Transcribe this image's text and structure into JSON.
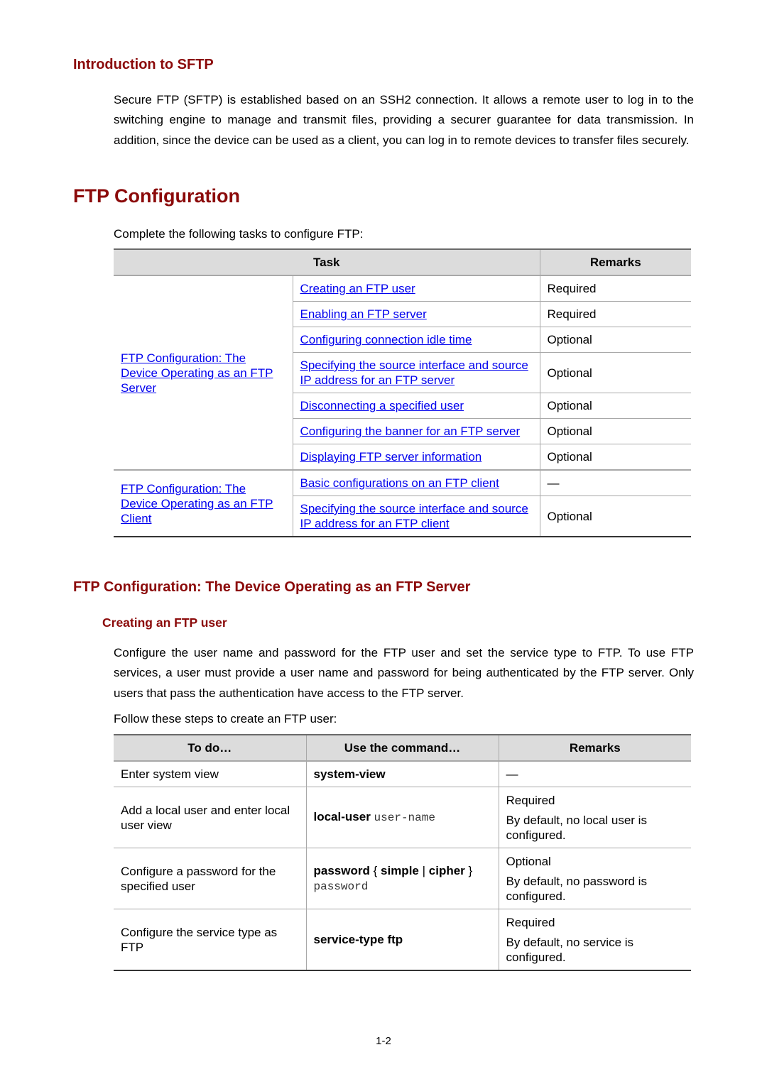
{
  "sections": {
    "intro": {
      "heading": "Introduction to SFTP",
      "paragraph": "Secure FTP (SFTP) is established based on an SSH2 connection. It allows a remote user to log in to the switching engine to manage and transmit files, providing a securer guarantee for data transmission. In addition, since the device can be used as a client, you can log in to remote devices to transfer files securely."
    },
    "ftp_config": {
      "heading": "FTP Configuration",
      "lead": "Complete the following tasks to configure FTP:",
      "table": {
        "headers": {
          "task": "Task",
          "remarks": "Remarks"
        },
        "groups": [
          {
            "label": "FTP Configuration: The Device Operating as an FTP Server",
            "rows": [
              {
                "task": "Creating an FTP user",
                "remarks": "Required"
              },
              {
                "task": "Enabling an FTP server",
                "remarks": "Required"
              },
              {
                "task": "Configuring connection idle time",
                "remarks": "Optional"
              },
              {
                "task": "Specifying the source interface and source IP address for an FTP server",
                "remarks": "Optional"
              },
              {
                "task": "Disconnecting a specified user",
                "remarks": "Optional"
              },
              {
                "task": "Configuring the banner for an FTP server",
                "remarks": "Optional"
              },
              {
                "task": "Displaying FTP server information",
                "remarks": "Optional"
              }
            ]
          },
          {
            "label": "FTP Configuration: The Device Operating as an FTP Client",
            "rows": [
              {
                "task": "Basic configurations on an FTP client",
                "remarks": "—"
              },
              {
                "task": "Specifying the source interface and source IP address for an FTP client",
                "remarks": "Optional"
              }
            ]
          }
        ]
      }
    },
    "server": {
      "heading": "FTP Configuration: The Device Operating as an FTP Server",
      "subheading": "Creating an FTP user",
      "paragraph": "Configure the user name and password for the FTP user and set the service type to FTP. To use FTP services, a user must provide a user name and password for being authenticated by the FTP server. Only users that pass the authentication have access to the FTP server.",
      "lead": "Follow these steps to create an FTP user:",
      "table": {
        "headers": {
          "todo": "To do…",
          "command": "Use the command…",
          "remarks": "Remarks"
        },
        "rows": [
          {
            "todo": "Enter system view",
            "cmd_bold": "system-view",
            "remarks": [
              "—"
            ]
          },
          {
            "todo": "Add a local user and enter local user view",
            "cmd_bold": "local-user",
            "cmd_arg": "user-name",
            "remarks": [
              "Required",
              "By default, no local user is configured."
            ]
          },
          {
            "todo": "Configure a password for the specified user",
            "cmd_bold": "password",
            "cmd_brace_open": "{",
            "cmd_opt1": "simple",
            "cmd_sep": "|",
            "cmd_opt2": "cipher",
            "cmd_brace_close": "}",
            "cmd_arg": "password",
            "remarks": [
              "Optional",
              "By default, no password is configured."
            ]
          },
          {
            "todo": "Configure the service type as FTP",
            "cmd_bold": "service-type ftp",
            "remarks": [
              "Required",
              "By default, no service is configured."
            ]
          }
        ]
      }
    }
  },
  "footer": {
    "page_number": "1-2"
  },
  "colors": {
    "heading": "#8b0a0a",
    "link": "#0000ee",
    "table_header_bg": "#dcdcdc"
  }
}
